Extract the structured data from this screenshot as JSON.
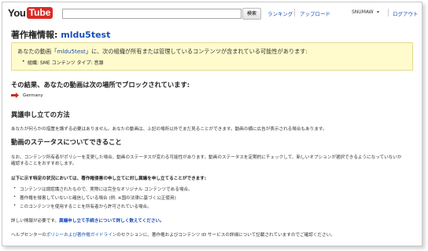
{
  "header": {
    "logo_you": "You",
    "logo_tube": "Tube",
    "search_placeholder": "",
    "search_button": "検索",
    "nav_ranking": "ランキング",
    "nav_upload": "アップロード",
    "username": "SNUMAW",
    "dropdown_caret": "▾",
    "logout": "ログアウト"
  },
  "page": {
    "title_prefix": "著作権情報: ",
    "video_name": "mldu5test"
  },
  "notice": {
    "line1_before": "あなたの動画「",
    "line1_link": "mldu5test",
    "line1_after": "」に、次の組織が所有または管理しているコンテンツが含まれている可能性があります:",
    "org_line": "組織: SME コンテンツ タイプ: 音源"
  },
  "blocked": {
    "heading": "その結果、あなたの動画は次の場所でブロックされています:",
    "country": "Germany"
  },
  "dispute": {
    "heading": "異議申し立ての方法",
    "text": "あなたが何らかの措置を講ずる必要はありません。あなたの動画は、上記の場所以外でまだ見ることができます。動画の横に広告が表示される場合もあります。"
  },
  "status": {
    "heading": "動画のステータスについてできること",
    "text1": "なお、コンテンツ所有者がポリシーを変更した場合、動画のステータスが変わる可能性があります。動画のステータスを定期的にチェックして、新しいオプションが選択できるようになっていないか",
    "text2": "確認することをおすすめします。"
  },
  "conditions": {
    "heading": "以下に示す特定の状況においては、著作権侵害の申し立てに対し異議を申し立てることができます:",
    "items": [
      "コンテンツは誤認識されたもので、実際には完全なオリジナル コンテンツである場合。",
      "著作権を侵害していないと確信している場合 (例: ※国の法律に基づく公正使用)",
      "このコンテンツを使用することを所有者から許可されている場合。"
    ]
  },
  "more_info": {
    "before": "詳しい情報が必要です。",
    "link": "異議申し立て手続きについて詳しく数えてください。"
  },
  "footer": {
    "before": "ヘルプセンターの",
    "link": "ポリシーおよび著作権ガイドライン",
    "after": "のセクションに、著作権およびコンテンツ ID サービスの詳細について記載されていますのでご確認ください。"
  },
  "colors": {
    "link": "#1a4fb5",
    "notice_bg": "#fffbcc",
    "arrow": "#cc2b25",
    "logo_red": "#d92b26"
  }
}
